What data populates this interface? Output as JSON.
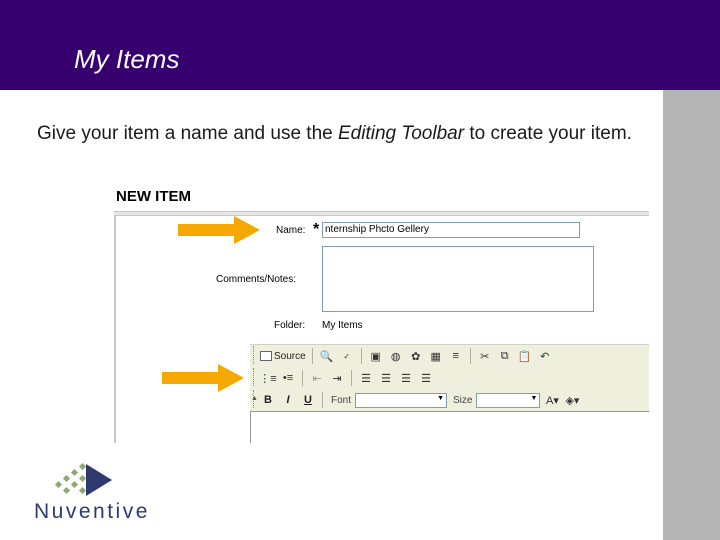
{
  "header": {
    "title": "My Items"
  },
  "intro": {
    "before": "Give your item a name and use the ",
    "emphasis": "Editing Toolbar",
    "after": " to create your item."
  },
  "form": {
    "heading": "NEW ITEM",
    "required_marker": "*",
    "name_label": "Name:",
    "name_value": "nternship Phcto Gellery",
    "comments_label": "Comments/Notes:",
    "folder_label": "Folder:",
    "folder_value": "My Items"
  },
  "toolbar": {
    "source_label": "Source",
    "bold_label": "B",
    "italic_label": "I",
    "underline_label": "U",
    "font_label": "Font",
    "size_label": "Size",
    "font_value": "",
    "size_value": ""
  },
  "logo": {
    "text": "Nuventive"
  },
  "colors": {
    "header_bg": "#36006e",
    "arrow": "#f5a800",
    "side_bar": "#b4b4b4",
    "toolbar_bg": "#efefde",
    "logo_text": "#2e3a6e"
  }
}
